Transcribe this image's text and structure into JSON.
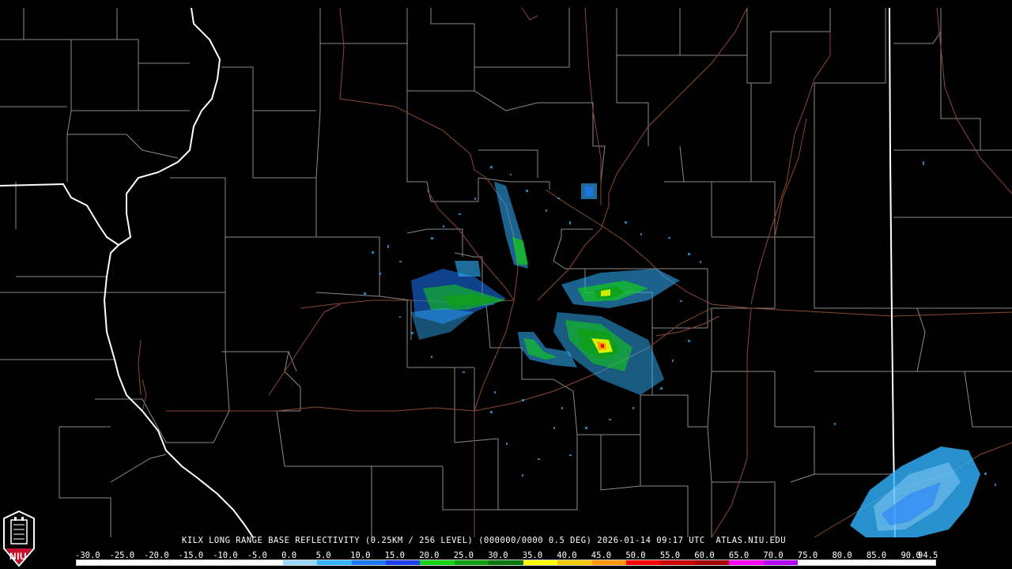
{
  "product_title": "KILX LONG RANGE BASE REFLECTIVITY (0.25KM / 256 LEVEL) (000000/0000 0.5 DEG) 2026-01-14 09:17 UTC  ATLAS.NIU.EDU",
  "colorbar": {
    "labels": [
      "-30.0",
      "-25.0",
      "-20.0",
      "-15.0",
      "-10.0",
      "-5.0",
      "0.0",
      "5.0",
      "10.0",
      "15.0",
      "20.0",
      "25.0",
      "30.0",
      "35.0",
      "40.0",
      "45.0",
      "50.0",
      "55.0",
      "60.0",
      "65.0",
      "70.0",
      "75.0",
      "80.0",
      "85.0",
      "90.0",
      "94.5"
    ],
    "colors": [
      "#ffffff",
      "#ffffff",
      "#ffffff",
      "#ffffff",
      "#ffffff",
      "#ffffff",
      "#9ad8ff",
      "#32b4ff",
      "#1e78ff",
      "#1e40f0",
      "#14d214",
      "#0fa00f",
      "#0a780a",
      "#ffff00",
      "#f0c800",
      "#ff9600",
      "#ff0000",
      "#c80000",
      "#a00000",
      "#ff00ff",
      "#b400ff",
      "#ffffff",
      "#ffffff",
      "#ffffff",
      "#ffffff"
    ]
  },
  "logo": {
    "text": "NIU",
    "bg_color": "#c8102e"
  },
  "map": {
    "state_border_color": "#ffffff",
    "county_border_color": "#9a9a9a",
    "highway_color": "#8b4a32",
    "background": "#000000"
  }
}
